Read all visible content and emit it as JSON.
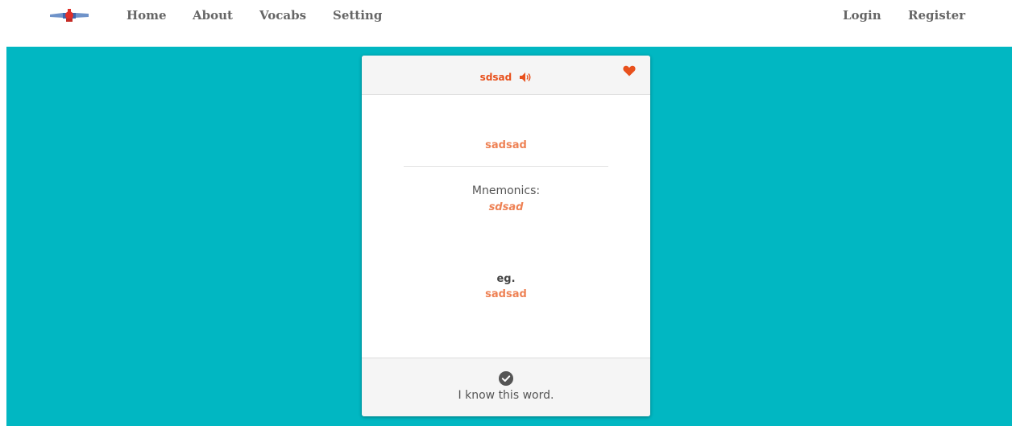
{
  "nav": {
    "links": [
      "Home",
      "About",
      "Vocabs",
      "Setting"
    ],
    "auth": [
      "Login",
      "Register"
    ]
  },
  "card": {
    "word": "sdsad",
    "meaning": "sadsad",
    "mnemonics_label": "Mnemonics:",
    "mnemonics_value": "sdsad",
    "example_label": "eg.",
    "example_value": "sadsad",
    "know_label": "I know this word."
  },
  "icons": {
    "speaker": "speaker-icon",
    "heart": "heart-icon",
    "check": "check-circle-icon",
    "logo": "logo-icon"
  },
  "colors": {
    "hero_bg": "#01b7c2",
    "accent": "#e8511d",
    "accent_soft": "#ee8255",
    "nav_text": "#666666"
  }
}
